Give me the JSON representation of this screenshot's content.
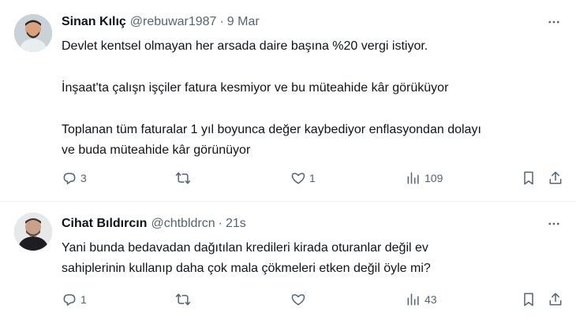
{
  "tweets": [
    {
      "name": "Sinan Kılıç",
      "handle": "@rebuwar1987",
      "time": "9 Mar",
      "lines": [
        "Devlet kentsel olmayan her arsada daire başına %20 vergi istiyor.",
        "İnşaat'ta çalışn işçiler fatura kesmiyor ve bu müteahide kâr görüküyor",
        "Toplanan tüm faturalar 1 yıl boyunca değer kaybediyor enflasyondan dolayı",
        "ve buda müteahide kâr görünüyor"
      ],
      "reply_count": "3",
      "retweet_count": "",
      "like_count": "1",
      "view_count": "109"
    },
    {
      "name": "Cihat Bıldırcın",
      "handle": "@chtbldrcn",
      "time": "21s",
      "lines": [
        "Yani bunda bedavadan dağıtılan kredileri kirada oturanlar değil ev",
        "sahiplerinin kullanıp daha çok mala çökmeleri etken değil öyle mi?"
      ],
      "reply_count": "1",
      "retweet_count": "",
      "like_count": "",
      "view_count": "43"
    }
  ],
  "icons": {
    "more": "more-dots-icon",
    "reply": "reply-bubble-icon",
    "retweet": "retweet-arrows-icon",
    "like": "heart-icon",
    "views": "bar-chart-icon",
    "bookmark": "bookmark-icon",
    "share": "share-upload-icon"
  },
  "colors": {
    "text": "#0f1419",
    "secondary": "#536471",
    "divider": "#eff3f4"
  }
}
